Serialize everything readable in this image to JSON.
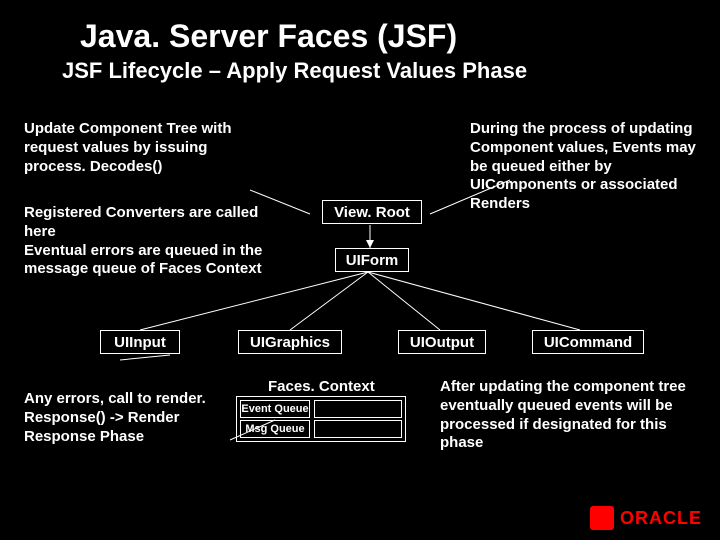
{
  "title": "Java. Server Faces (JSF)",
  "subtitle": "JSF Lifecycle – Apply Request Values Phase",
  "txt_topleft": "Update Component Tree with request values by issuing process. Decodes()",
  "txt_midleft": "Registered Converters are called here\nEventual errors are queued in the message queue of Faces Context",
  "txt_topright": "During the process of updating Component values, Events may be queued either by UIComponents or associated Renders",
  "txt_botleft": "Any errors, call to render. Response() -> Render Response Phase",
  "txt_botright": "After updating the component tree eventually queued events will be processed if designated for this phase",
  "nodes": {
    "viewroot": "View. Root",
    "uiform": "UIForm",
    "uiinput": "UIInput",
    "uigraphics": "UIGraphics",
    "uioutput": "UIOutput",
    "uicommand": "UICommand"
  },
  "faces": {
    "title": "Faces. Context",
    "row1": "Event Queue",
    "row2": "Msg Queue"
  },
  "brand": "ORACLE"
}
